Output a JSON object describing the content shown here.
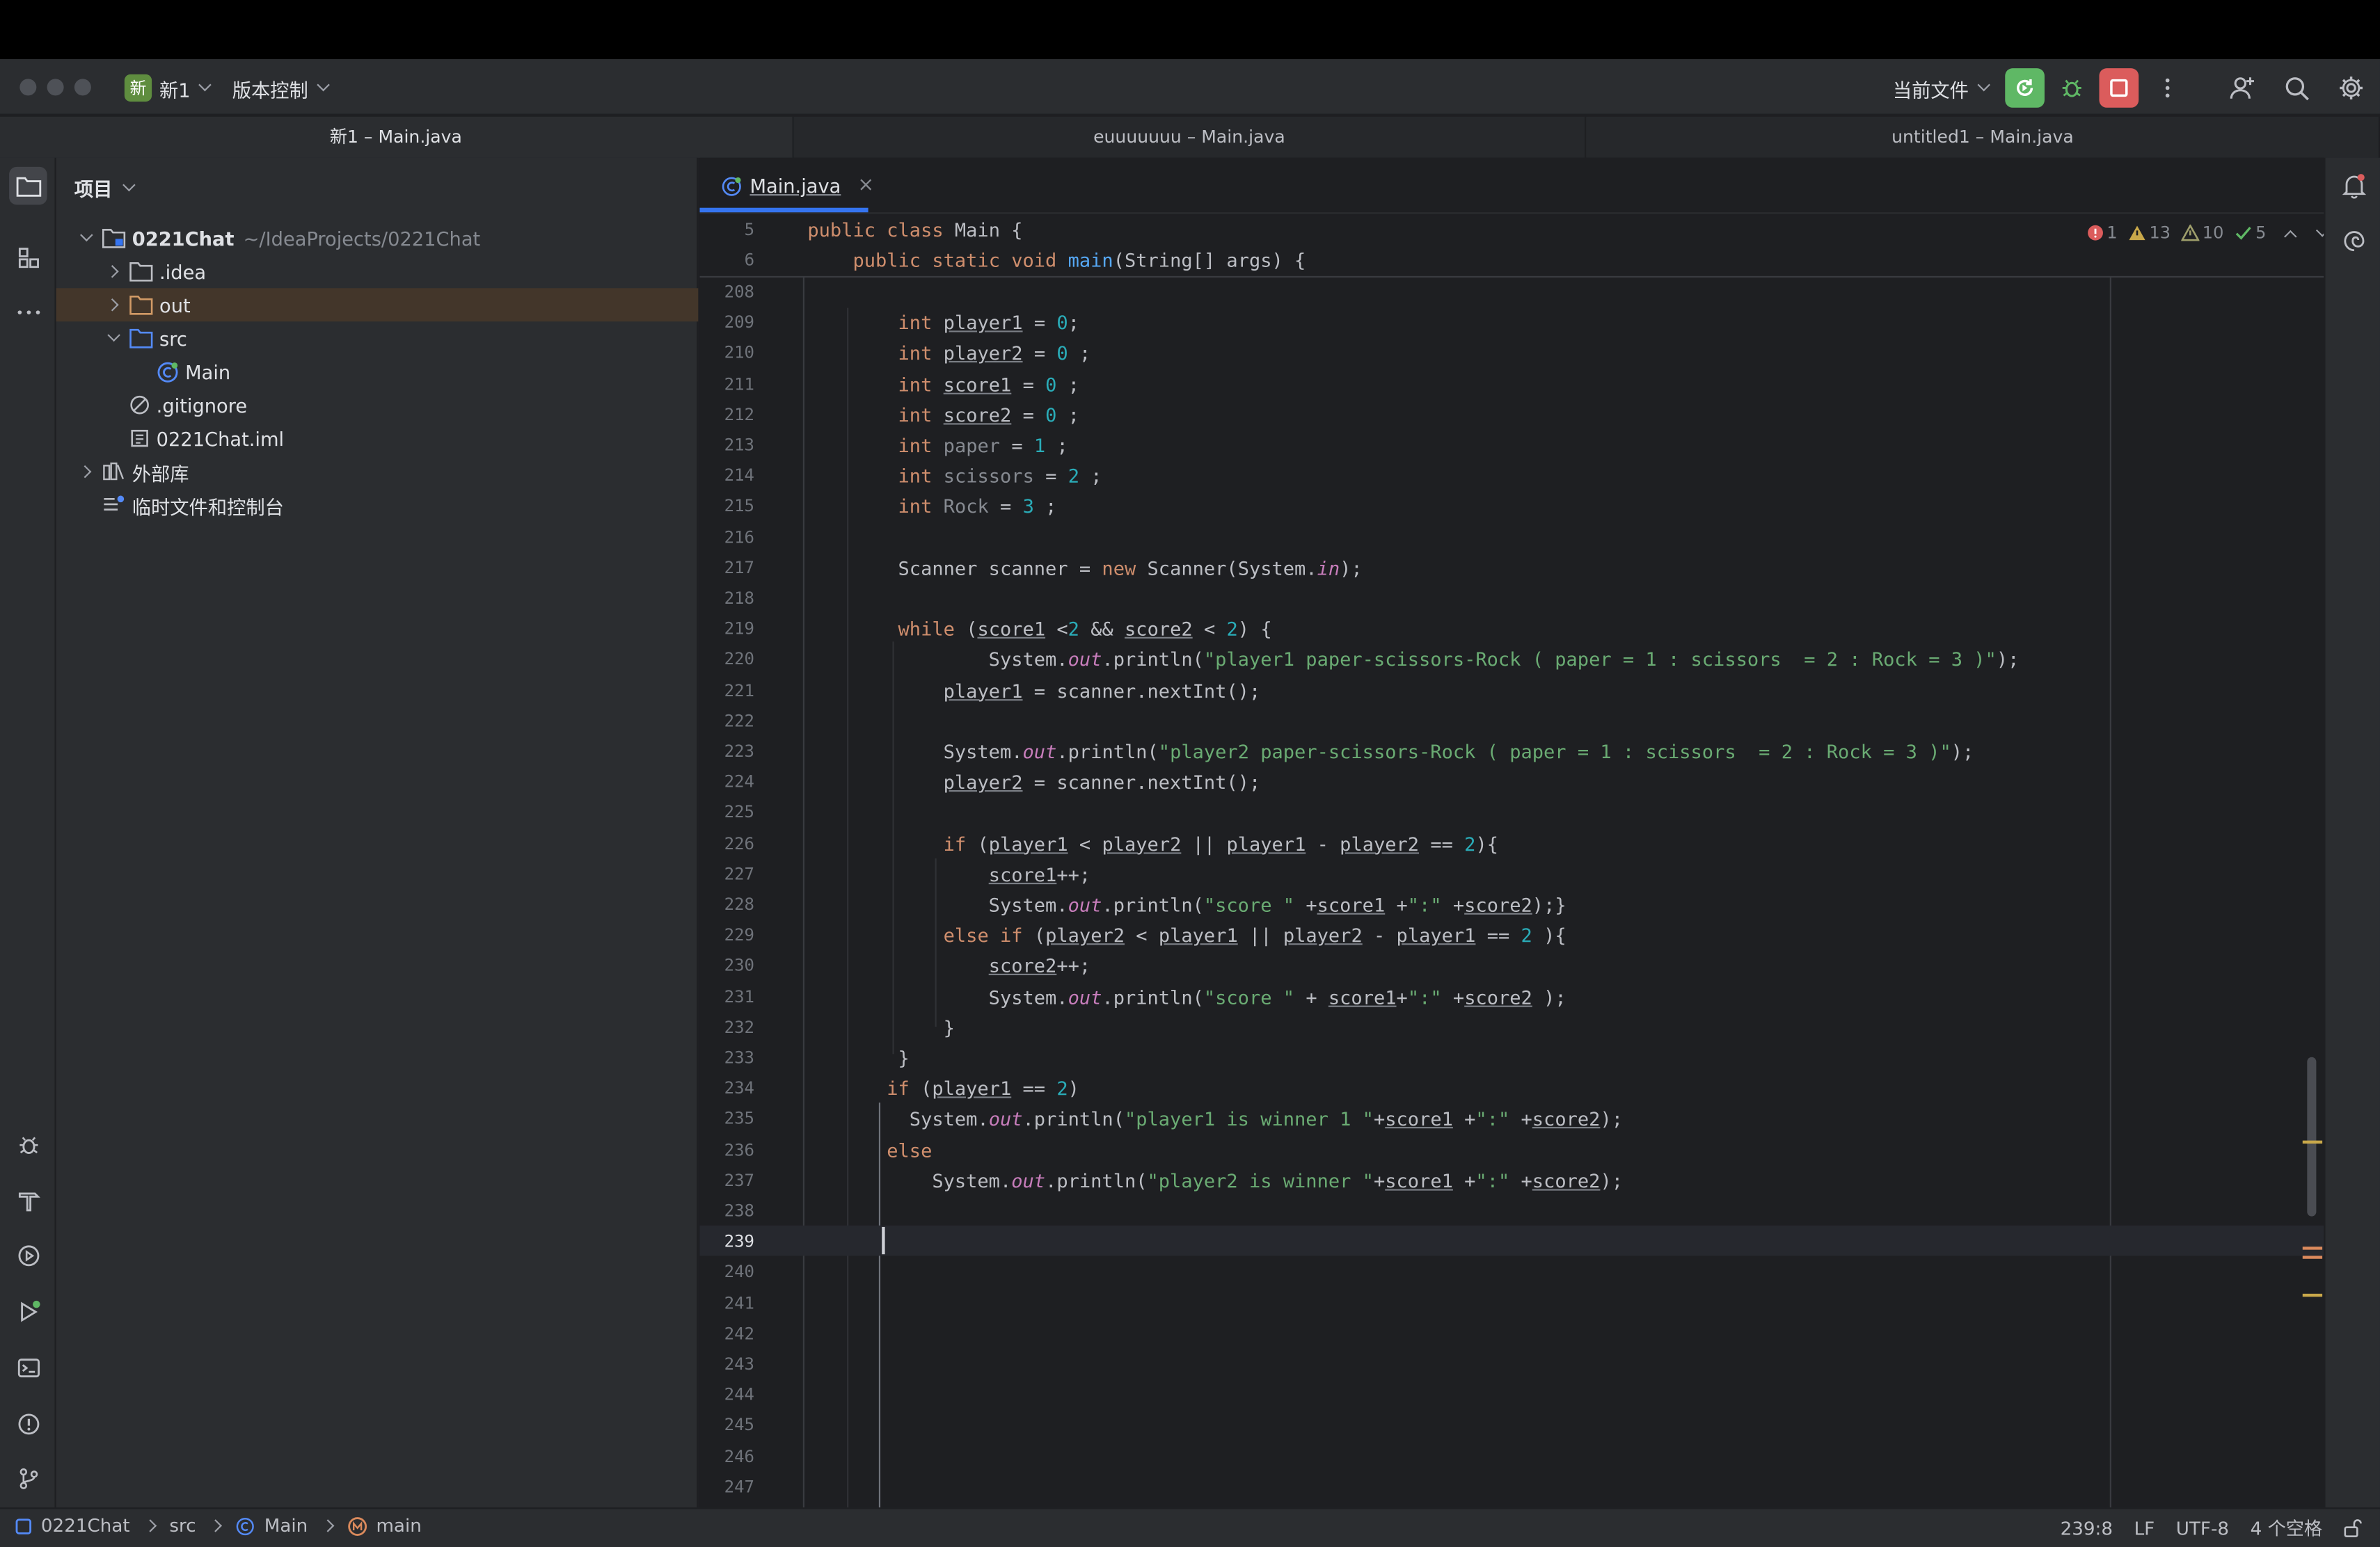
{
  "titlebar": {
    "project_badge": "新",
    "project_name": "新1",
    "vcs_label": "版本控制",
    "run_config": "当前文件"
  },
  "window_tabs": [
    "新1 – Main.java",
    "euuuuuuu – Main.java",
    "untitled1 – Main.java"
  ],
  "project_panel": {
    "title": "项目",
    "root_name": "0221Chat",
    "root_path": "~/IdeaProjects/0221Chat",
    "items": [
      {
        "label": ".idea"
      },
      {
        "label": "out"
      },
      {
        "label": "src"
      },
      {
        "label": "Main"
      },
      {
        "label": ".gitignore"
      },
      {
        "label": "0221Chat.iml"
      },
      {
        "label": "外部库"
      },
      {
        "label": "临时文件和控制台"
      }
    ]
  },
  "editor": {
    "tab_label": "Main.java",
    "inspections": {
      "errors": "1",
      "warnings": "13",
      "weak_warnings": "10",
      "ok": "5"
    },
    "sticky_lines": [
      {
        "num": "5",
        "text": "public class Main {"
      },
      {
        "num": "6",
        "text": "    public static void main(String[] args) {"
      }
    ],
    "line_numbers": [
      "208",
      "209",
      "210",
      "211",
      "212",
      "213",
      "214",
      "215",
      "216",
      "217",
      "218",
      "219",
      "220",
      "221",
      "222",
      "223",
      "224",
      "225",
      "226",
      "227",
      "228",
      "229",
      "230",
      "231",
      "232",
      "233",
      "234",
      "235",
      "236",
      "237",
      "238",
      "239",
      "240",
      "241",
      "242",
      "243",
      "244",
      "245",
      "246",
      "247"
    ],
    "code_lines": [
      "",
      "        int player1 = 0;",
      "        int player2 = 0 ;",
      "        int score1 = 0 ;",
      "        int score2 = 0 ;",
      "        int paper = 1 ;",
      "        int scissors = 2 ;",
      "        int Rock = 3 ;",
      "",
      "        Scanner scanner = new Scanner(System.in);",
      "",
      "        while (score1 <2 && score2 < 2) {",
      "                System.out.println(\"player1 paper-scissors-Rock ( paper = 1 : scissors  = 2 : Rock = 3 )\");",
      "            player1 = scanner.nextInt();",
      "",
      "            System.out.println(\"player2 paper-scissors-Rock ( paper = 1 : scissors  = 2 : Rock = 3 )\");",
      "            player2 = scanner.nextInt();",
      "",
      "            if (player1 < player2 || player1 - player2 == 2){",
      "                score1++;",
      "                System.out.println(\"score \" +score1 +\":\" +score2);}",
      "            else if (player2 < player1 || player2 - player1 == 2 ){",
      "                score2++;",
      "                System.out.println(\"score \" + score1+\":\" +score2 );",
      "            }",
      "        }",
      "       if (player1 == 2)",
      "         System.out.println(\"player1 is winner 1 \"+score1 +\":\" +score2);",
      "       else",
      "           System.out.println(\"player2 is winner \"+score1 +\":\" +score2);",
      "",
      "       ",
      "",
      "",
      "",
      "",
      "",
      "",
      "",
      ""
    ],
    "current_line": "239"
  },
  "statusbar": {
    "breadcrumbs": [
      "0221Chat",
      "src",
      "Main",
      "main"
    ],
    "position": "239:8",
    "line_sep": "LF",
    "encoding": "UTF-8",
    "indent": "4 个空格"
  },
  "colors": {
    "accent": "#3574f0",
    "keyword": "#cf8e6d",
    "number": "#2aacb8",
    "string": "#6aab73",
    "field": "#c77dbb",
    "run_green": "#5fb865",
    "stop_red": "#db5c5c"
  }
}
